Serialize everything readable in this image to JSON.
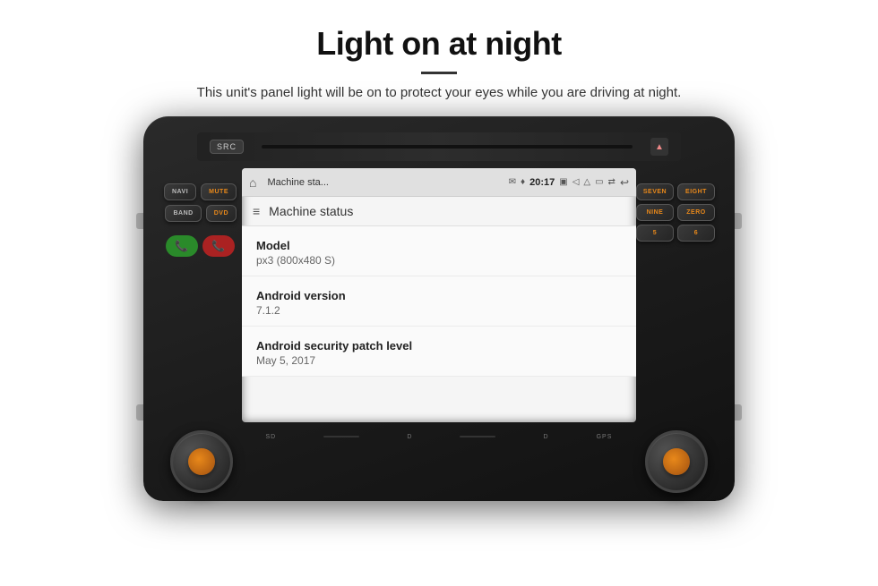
{
  "page": {
    "title": "Light on at night",
    "subtitle": "This unit's panel light will be on to protect your eyes while you are driving at night."
  },
  "android": {
    "status_bar": {
      "app_name": "Machine sta...",
      "message_icon": "...",
      "time": "20:17"
    },
    "app_header_title": "Machine status",
    "fields": [
      {
        "label": "Model",
        "value": "px3 (800x480 S)"
      },
      {
        "label": "Android version",
        "value": "7.1.2"
      },
      {
        "label": "Android security patch level",
        "value": "May 5, 2017"
      }
    ]
  },
  "unit": {
    "left_buttons": [
      {
        "label": "NAVI",
        "orange": false
      },
      {
        "label": "MUTE",
        "orange": true
      },
      {
        "label": "BAND",
        "orange": false
      },
      {
        "label": "DVD",
        "orange": true
      }
    ],
    "right_buttons": [
      {
        "label": "SEVEN",
        "orange": true
      },
      {
        "label": "EIGHT",
        "orange": true
      },
      {
        "label": "NINE",
        "orange": true
      },
      {
        "label": "ZERO",
        "orange": true
      },
      {
        "label": "5",
        "orange": true
      },
      {
        "label": "6",
        "orange": true
      }
    ],
    "bottom_labels": [
      "SD",
      "D",
      "D",
      "GPS"
    ]
  }
}
